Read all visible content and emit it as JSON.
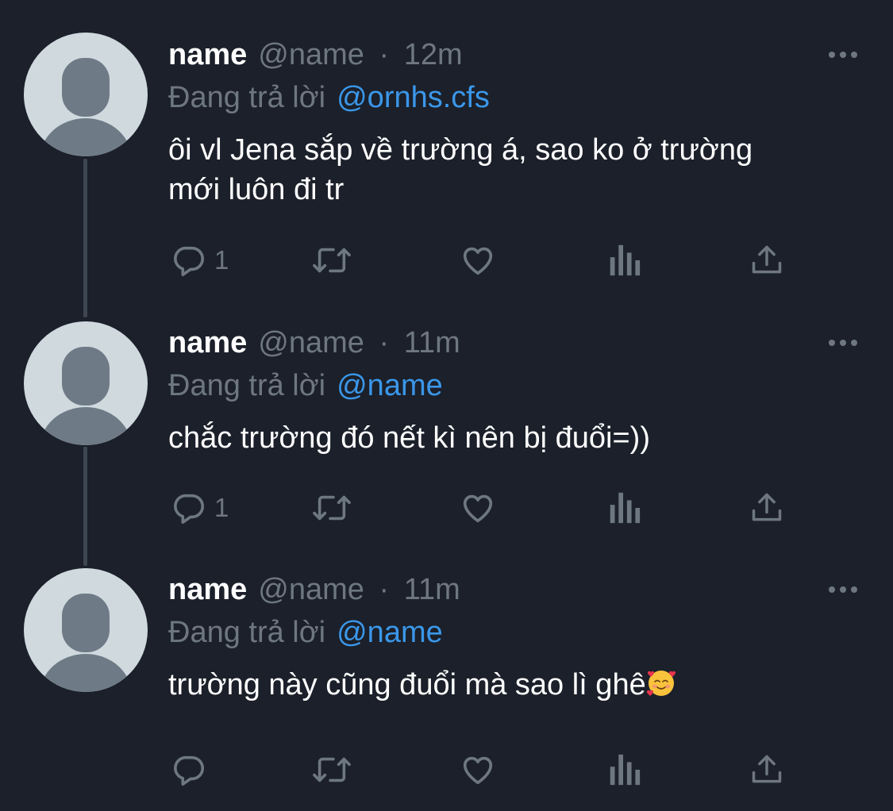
{
  "colors": {
    "background": "#1b202a",
    "text_primary": "#ffffff",
    "text_secondary": "#6e7781",
    "link": "#3b97e9",
    "thread_line": "#3e4651",
    "avatar_bg": "#cfd9de",
    "avatar_figure": "#6e7b86"
  },
  "tweets": [
    {
      "display_name": "name",
      "handle": "@name",
      "separator": "·",
      "time": "12m",
      "reply_prefix": "Đang trả lời",
      "reply_to": "@ornhs.cfs",
      "text_lines": [
        "ôi vl Jena sắp về trường á, sao ko ở trường",
        "mới luôn đi tr"
      ],
      "reply_count": "1",
      "icons": [
        "reply-icon",
        "retweet-icon",
        "like-icon",
        "analytics-icon",
        "share-icon",
        "more-icon"
      ]
    },
    {
      "display_name": "name",
      "handle": "@name",
      "separator": "·",
      "time": "11m",
      "reply_prefix": "Đang trả lời",
      "reply_to": "@name",
      "text_lines": [
        "chắc trường đó nết kì nên bị đuổi=))"
      ],
      "reply_count": "1",
      "icons": [
        "reply-icon",
        "retweet-icon",
        "like-icon",
        "analytics-icon",
        "share-icon",
        "more-icon"
      ]
    },
    {
      "display_name": "name",
      "handle": "@name",
      "separator": "·",
      "time": "11m",
      "reply_prefix": "Đang trả lời",
      "reply_to": "@name",
      "text_lines": [
        "trường này cũng đuổi mà sao lì ghê"
      ],
      "emoji": "smiling-face-with-hearts",
      "icons": [
        "reply-icon",
        "retweet-icon",
        "like-icon",
        "analytics-icon",
        "share-icon",
        "more-icon"
      ]
    }
  ]
}
